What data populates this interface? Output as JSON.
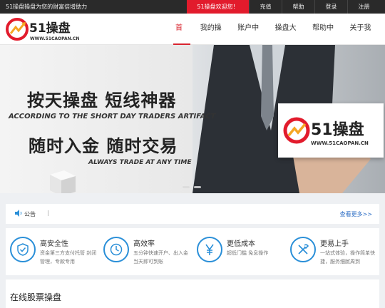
{
  "topbar": {
    "slogan": "51操盘操盘为您的财富倍增助力",
    "welcome": "51操盘欢迎您！",
    "links": [
      "充值",
      "帮助",
      "登录",
      "注册"
    ]
  },
  "logo": {
    "name": "51操盘",
    "url": "WWW.51CAOPAN.CN"
  },
  "nav": [
    "首页",
    "我的操盘",
    "账户中心",
    "操盘大赛",
    "帮助中心",
    "关于我们"
  ],
  "banner": {
    "title1": "按天操盘 短线神器",
    "subtitle1": "ACCORDING TO THE SHORT DAY TRADERS ARTIFACT",
    "title2": "随时入金 随时交易",
    "subtitle2": "ALWAYS TRADE AT ANY TIME",
    "card_name": "51操盘",
    "card_url": "WWW.51CAOPAN.CN"
  },
  "notice": {
    "label": "公告",
    "separator": "|",
    "more": "查看更多>>"
  },
  "features": [
    {
      "title": "高安全性",
      "desc": "资金第三方支付托管 封闭管理，专款专用",
      "icon": "shield-icon"
    },
    {
      "title": "高效率",
      "desc": "五分钟快速开户、出入金当天即可到账",
      "icon": "clock-icon"
    },
    {
      "title": "更低成本",
      "desc": "超低门槛 免息操作",
      "icon": "yuan-icon"
    },
    {
      "title": "更易上手",
      "desc": "一站式体验，操作简单快捷，服务细腻周到",
      "icon": "tools-icon"
    }
  ],
  "stock": {
    "title": "在线股票操盘"
  },
  "colors": {
    "accent": "#e21b2c",
    "blue": "#2a8fd8"
  }
}
